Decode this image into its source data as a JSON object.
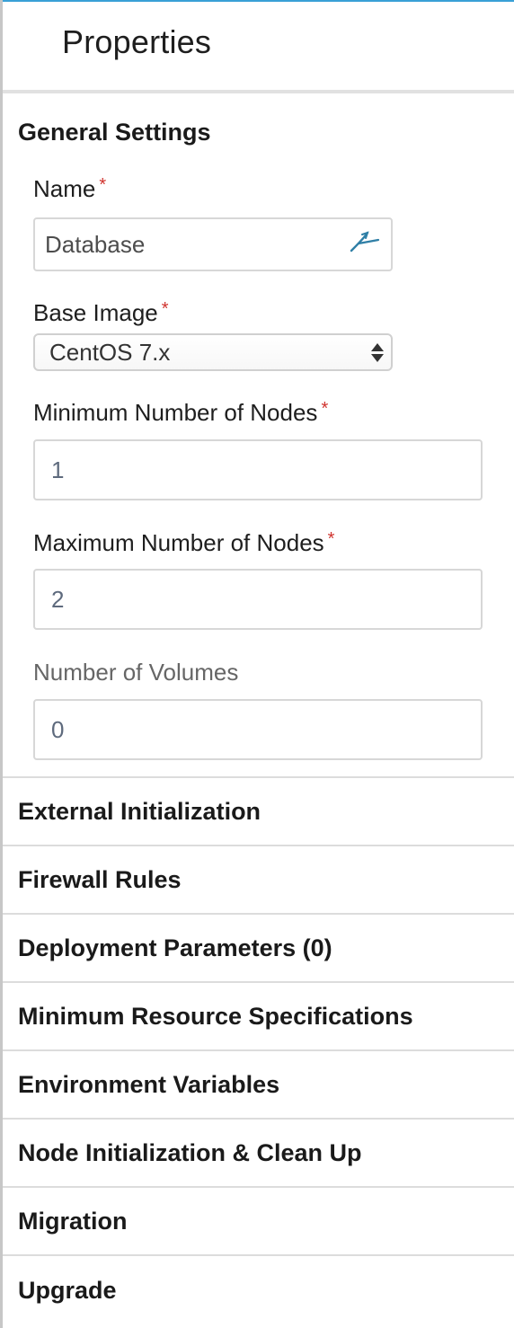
{
  "panel": {
    "title": "Properties",
    "accent_color": "#39a0d6"
  },
  "general_settings": {
    "title": "General Settings",
    "required_marker": "*",
    "name": {
      "label": "Name",
      "value": "Database",
      "icon": "pen-sign-icon"
    },
    "base_image": {
      "label": "Base Image",
      "selected": "CentOS 7.x"
    },
    "min_nodes": {
      "label": "Minimum Number of Nodes",
      "value": "1"
    },
    "max_nodes": {
      "label": "Maximum Number of Nodes",
      "value": "2"
    },
    "volumes": {
      "label": "Number of Volumes",
      "value": "0"
    }
  },
  "sections": [
    {
      "label": "External Initialization"
    },
    {
      "label": "Firewall Rules"
    },
    {
      "label": "Deployment Parameters (0)"
    },
    {
      "label": "Minimum Resource Specifications"
    },
    {
      "label": "Environment Variables"
    },
    {
      "label": "Node Initialization & Clean Up"
    },
    {
      "label": "Migration"
    },
    {
      "label": "Upgrade"
    }
  ]
}
